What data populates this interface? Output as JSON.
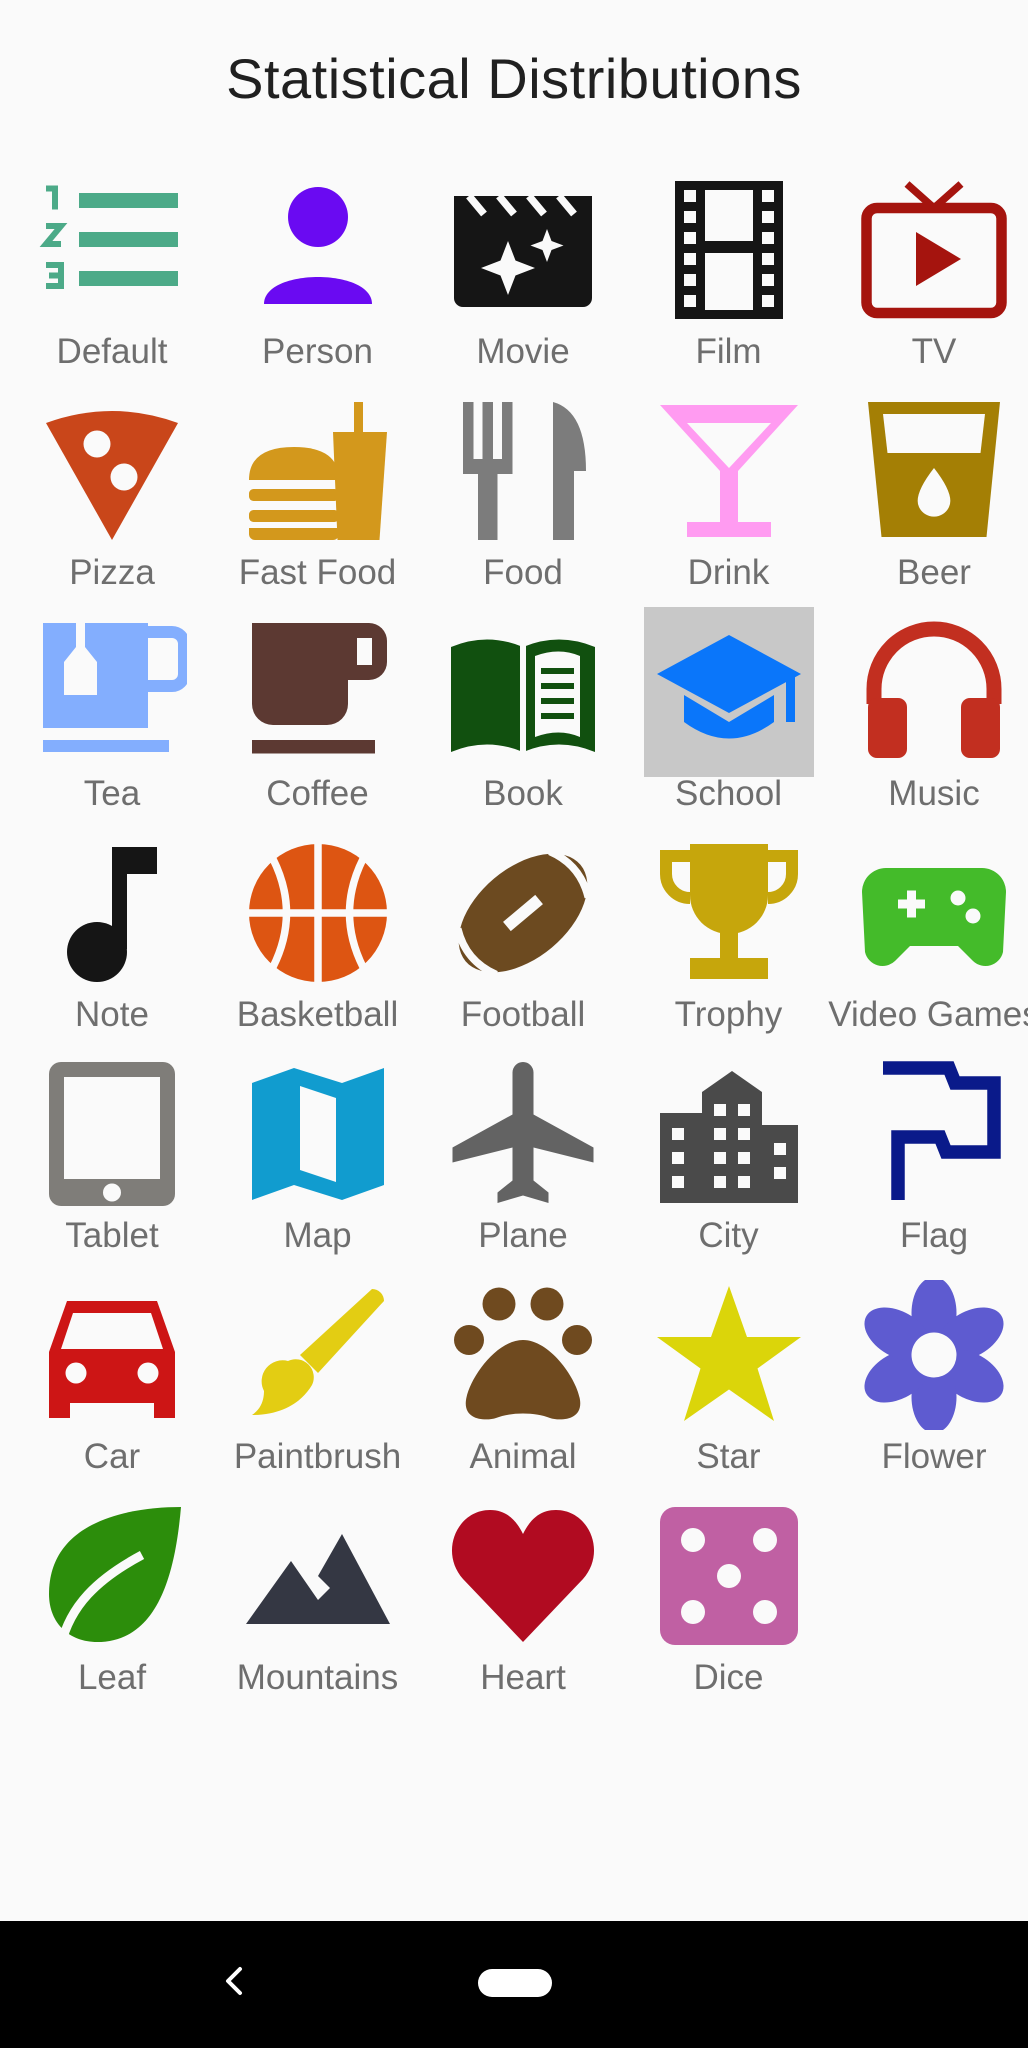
{
  "title": "Statistical Distributions",
  "icons": [
    {
      "label": "Default",
      "icon": "numbered-list-icon",
      "color": "#4caa88"
    },
    {
      "label": "Person",
      "icon": "person-icon",
      "color": "#6a0af2"
    },
    {
      "label": "Movie",
      "icon": "movie-icon",
      "color": "#151515"
    },
    {
      "label": "Film",
      "icon": "film-icon",
      "color": "#151515"
    },
    {
      "label": "TV",
      "icon": "tv-icon",
      "color": "#a5140e"
    },
    {
      "label": "Pizza",
      "icon": "pizza-icon",
      "color": "#c9461a"
    },
    {
      "label": "Fast Food",
      "icon": "fast-food-icon",
      "color": "#d3981c"
    },
    {
      "label": "Food",
      "icon": "food-icon",
      "color": "#7c7c7c"
    },
    {
      "label": "Drink",
      "icon": "drink-icon",
      "color": "#ff9bf1"
    },
    {
      "label": "Beer",
      "icon": "beer-icon",
      "color": "#a47f05"
    },
    {
      "label": "Tea",
      "icon": "tea-icon",
      "color": "#83aefe"
    },
    {
      "label": "Coffee",
      "icon": "coffee-icon",
      "color": "#5c3932"
    },
    {
      "label": "Book",
      "icon": "book-icon",
      "color": "#11500f"
    },
    {
      "label": "School",
      "icon": "school-icon",
      "color": "#0a76fa",
      "selected": true
    },
    {
      "label": "Music",
      "icon": "headphones-icon",
      "color": "#c22f20"
    },
    {
      "label": "Note",
      "icon": "music-note-icon",
      "color": "#151515"
    },
    {
      "label": "Basketball",
      "icon": "basketball-icon",
      "color": "#dd5512"
    },
    {
      "label": "Football",
      "icon": "football-icon",
      "color": "#6c4a20"
    },
    {
      "label": "Trophy",
      "icon": "trophy-icon",
      "color": "#c6a60c"
    },
    {
      "label": "Video Games",
      "icon": "gamepad-icon",
      "color": "#44bb2a"
    },
    {
      "label": "Tablet",
      "icon": "tablet-icon",
      "color": "#7f7d79"
    },
    {
      "label": "Map",
      "icon": "map-icon",
      "color": "#119ccf"
    },
    {
      "label": "Plane",
      "icon": "plane-icon",
      "color": "#636363"
    },
    {
      "label": "City",
      "icon": "city-icon",
      "color": "#4a4a4a"
    },
    {
      "label": "Flag",
      "icon": "flag-icon",
      "color": "#0a1a8a"
    },
    {
      "label": "Car",
      "icon": "car-icon",
      "color": "#cd1515"
    },
    {
      "label": "Paintbrush",
      "icon": "paintbrush-icon",
      "color": "#e3cd13"
    },
    {
      "label": "Animal",
      "icon": "paw-icon",
      "color": "#6f4a1f"
    },
    {
      "label": "Star",
      "icon": "star-icon",
      "color": "#dbd50a"
    },
    {
      "label": "Flower",
      "icon": "flower-icon",
      "color": "#5e5bd0"
    },
    {
      "label": "Leaf",
      "icon": "leaf-icon",
      "color": "#2c8d0b"
    },
    {
      "label": "Mountains",
      "icon": "mountains-icon",
      "color": "#343743"
    },
    {
      "label": "Heart",
      "icon": "heart-icon",
      "color": "#b10b21"
    },
    {
      "label": "Dice",
      "icon": "dice-icon",
      "color": "#c060a3"
    }
  ],
  "nav": {
    "back_icon": "back-chevron-icon",
    "home_icon": "home-pill-icon"
  }
}
